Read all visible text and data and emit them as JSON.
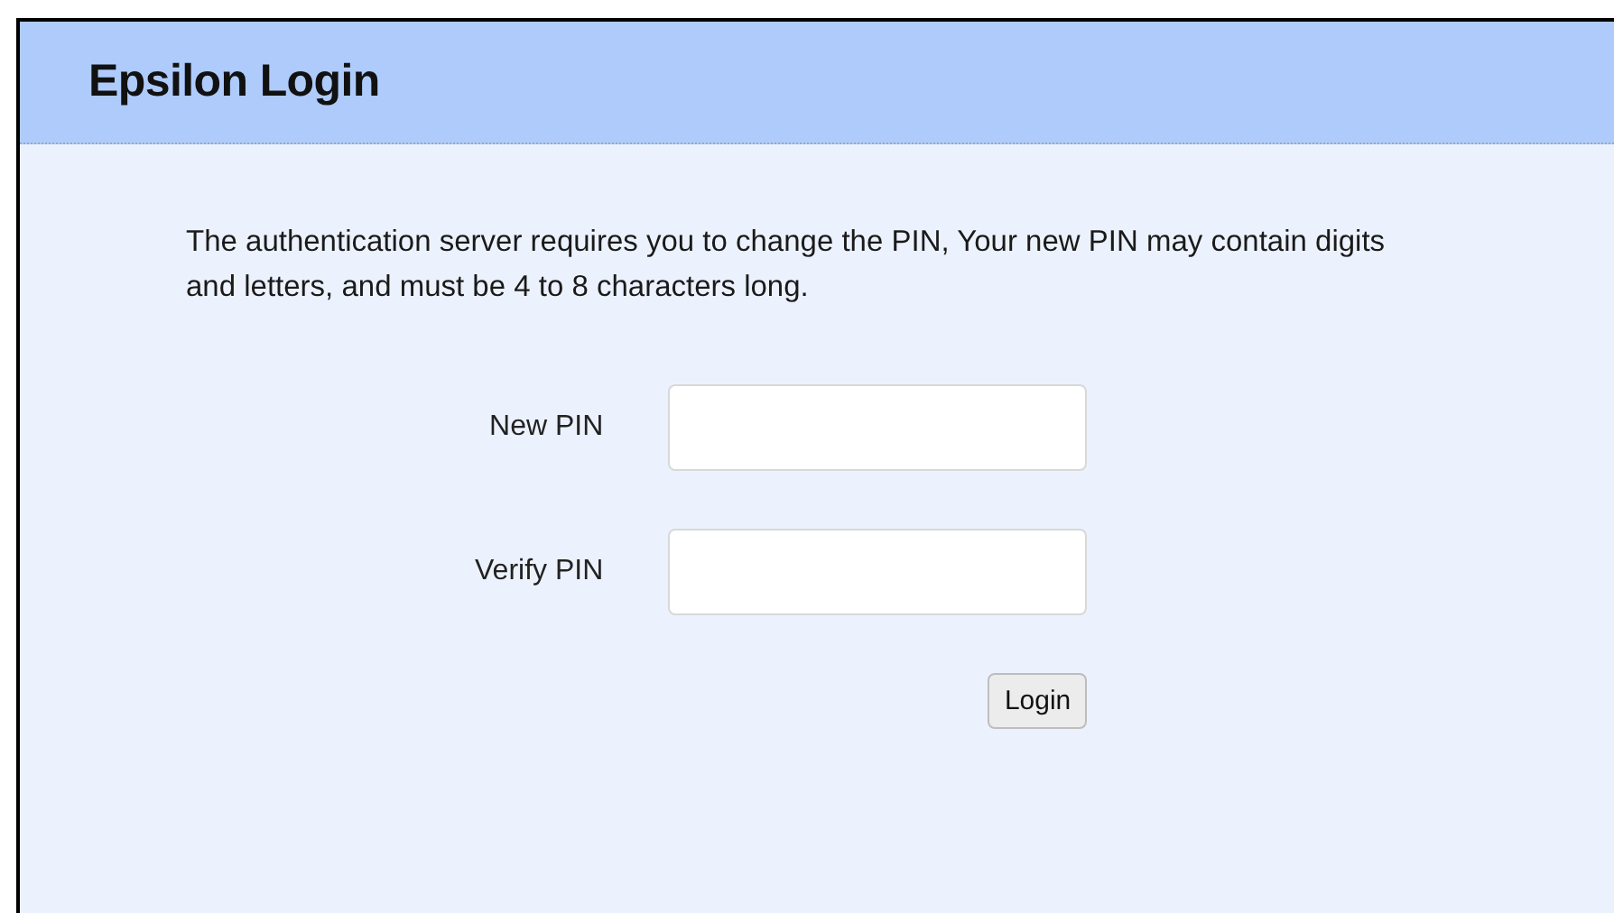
{
  "header": {
    "title": "Epsilon Login"
  },
  "message": "The authentication server requires you to change the PIN, Your new PIN may contain digits and letters, and must be 4 to 8 characters long.",
  "fields": [
    {
      "label": "New PIN"
    },
    {
      "label": "Verify PIN"
    }
  ],
  "submit": "Login"
}
